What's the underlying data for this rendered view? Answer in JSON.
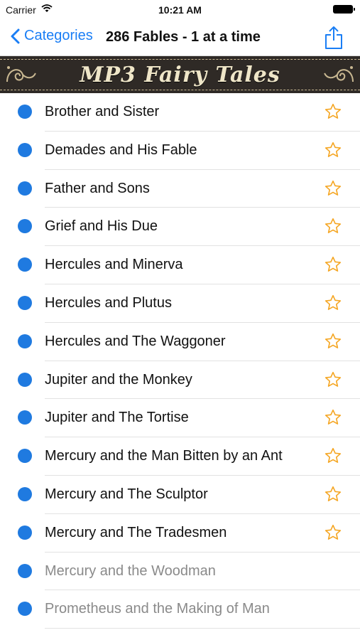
{
  "status_bar": {
    "carrier": "Carrier",
    "time": "10:21 AM"
  },
  "nav": {
    "back_label": "Categories",
    "title": "286 Fables - 1 at a time"
  },
  "banner": {
    "title": "MP3 Fairy Tales"
  },
  "colors": {
    "accent": "#1a7ef5",
    "dot": "#1f7ae0",
    "star": "#f5a623",
    "banner_bg": "#2f2a26"
  },
  "fables": [
    {
      "title": "Brother and Sister",
      "favorite_icon": "star-outline"
    },
    {
      "title": "Demades and His Fable",
      "favorite_icon": "star-outline"
    },
    {
      "title": "Father and Sons",
      "favorite_icon": "star-outline"
    },
    {
      "title": "Grief and His Due",
      "favorite_icon": "star-outline"
    },
    {
      "title": "Hercules and Minerva",
      "favorite_icon": "star-outline"
    },
    {
      "title": "Hercules and Plutus",
      "favorite_icon": "star-outline"
    },
    {
      "title": "Hercules and The Waggoner",
      "favorite_icon": "star-outline"
    },
    {
      "title": "Jupiter and the Monkey",
      "favorite_icon": "star-outline"
    },
    {
      "title": "Jupiter and The Tortise",
      "favorite_icon": "star-outline"
    },
    {
      "title": "Mercury and the Man Bitten by an Ant",
      "favorite_icon": "star-outline"
    },
    {
      "title": "Mercury and The Sculptor",
      "favorite_icon": "star-outline"
    },
    {
      "title": "Mercury and The Tradesmen",
      "favorite_icon": "star-outline"
    },
    {
      "title": "Mercury and the Woodman",
      "favorite_icon": "none"
    },
    {
      "title": "Prometheus and the Making of Man",
      "favorite_icon": "none"
    }
  ]
}
